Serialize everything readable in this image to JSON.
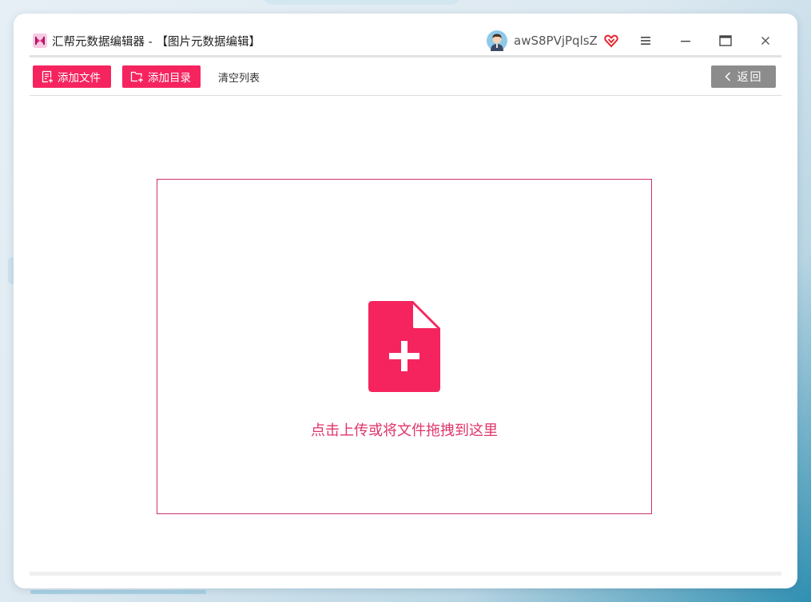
{
  "window": {
    "title": "汇帮元数据编辑器 - 【图片元数据编辑】"
  },
  "user": {
    "name": "awS8PVjPqlsZ"
  },
  "toolbar": {
    "add_file_label": "添加文件",
    "add_folder_label": "添加目录",
    "clear_list_label": "清空列表",
    "back_label": "返回"
  },
  "dropzone": {
    "hint": "点击上传或将文件拖拽到这里"
  },
  "colors": {
    "accent": "#f5245f",
    "dropzone_border": "#c8326e",
    "back_button": "#8c8c8c"
  },
  "icons": [
    "app-logo",
    "user-avatar",
    "vip-heart-icon",
    "menu-icon",
    "minimize-icon",
    "maximize-icon",
    "close-icon",
    "add-file-icon",
    "add-folder-icon",
    "chevron-left-icon",
    "file-plus-icon"
  ]
}
